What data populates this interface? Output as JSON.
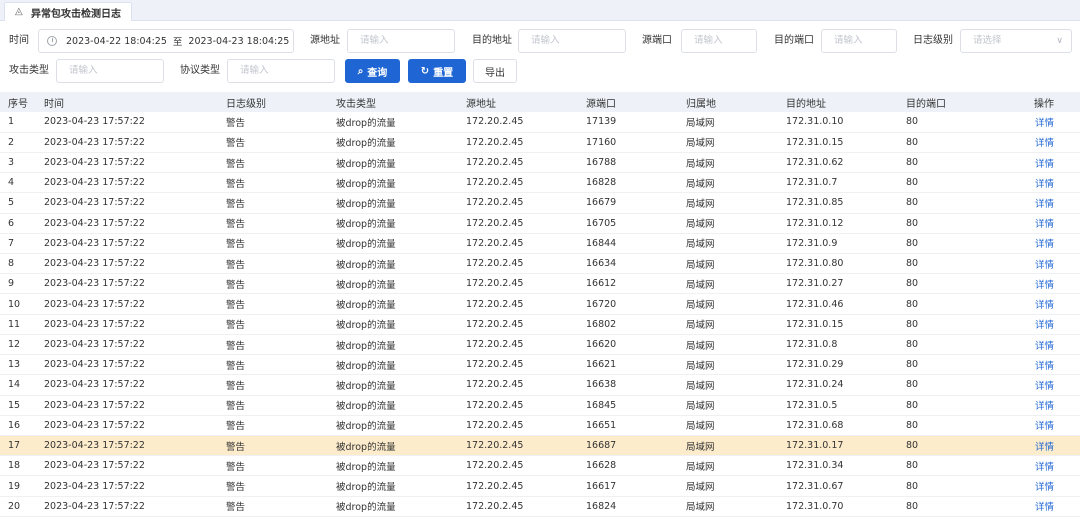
{
  "tab": {
    "title": "异常包攻击检测日志"
  },
  "filters": {
    "time_label": "时间",
    "date_start": "2023-04-22 18:04:25",
    "date_sep": "至",
    "date_end": "2023-04-23 18:04:25",
    "src_addr_label": "源地址",
    "dst_addr_label": "目的地址",
    "src_port_label": "源端口",
    "dst_port_label": "目的端口",
    "log_level_label": "日志级别",
    "attack_type_label": "攻击类型",
    "protocol_label": "协议类型",
    "input_placeholder": "请输入",
    "select_placeholder": "请选择",
    "search_btn": "查询",
    "reset_btn": "重置",
    "export_btn": "导出"
  },
  "table": {
    "headers": [
      "序号",
      "时间",
      "日志级别",
      "攻击类型",
      "源地址",
      "源端口",
      "归属地",
      "目的地址",
      "目的端口",
      "操作"
    ],
    "highlight_row": 17,
    "highlight_color": "#fdeccb",
    "accent_color": "#1f66d4",
    "rows": [
      [
        "1",
        "2023-04-23 17:57:22",
        "警告",
        "被drop的流量",
        "172.20.2.45",
        "17139",
        "局域网",
        "172.31.0.10",
        "80",
        "详情"
      ],
      [
        "2",
        "2023-04-23 17:57:22",
        "警告",
        "被drop的流量",
        "172.20.2.45",
        "17160",
        "局域网",
        "172.31.0.15",
        "80",
        "详情"
      ],
      [
        "3",
        "2023-04-23 17:57:22",
        "警告",
        "被drop的流量",
        "172.20.2.45",
        "16788",
        "局域网",
        "172.31.0.62",
        "80",
        "详情"
      ],
      [
        "4",
        "2023-04-23 17:57:22",
        "警告",
        "被drop的流量",
        "172.20.2.45",
        "16828",
        "局域网",
        "172.31.0.7",
        "80",
        "详情"
      ],
      [
        "5",
        "2023-04-23 17:57:22",
        "警告",
        "被drop的流量",
        "172.20.2.45",
        "16679",
        "局域网",
        "172.31.0.85",
        "80",
        "详情"
      ],
      [
        "6",
        "2023-04-23 17:57:22",
        "警告",
        "被drop的流量",
        "172.20.2.45",
        "16705",
        "局域网",
        "172.31.0.12",
        "80",
        "详情"
      ],
      [
        "7",
        "2023-04-23 17:57:22",
        "警告",
        "被drop的流量",
        "172.20.2.45",
        "16844",
        "局域网",
        "172.31.0.9",
        "80",
        "详情"
      ],
      [
        "8",
        "2023-04-23 17:57:22",
        "警告",
        "被drop的流量",
        "172.20.2.45",
        "16634",
        "局域网",
        "172.31.0.80",
        "80",
        "详情"
      ],
      [
        "9",
        "2023-04-23 17:57:22",
        "警告",
        "被drop的流量",
        "172.20.2.45",
        "16612",
        "局域网",
        "172.31.0.27",
        "80",
        "详情"
      ],
      [
        "10",
        "2023-04-23 17:57:22",
        "警告",
        "被drop的流量",
        "172.20.2.45",
        "16720",
        "局域网",
        "172.31.0.46",
        "80",
        "详情"
      ],
      [
        "11",
        "2023-04-23 17:57:22",
        "警告",
        "被drop的流量",
        "172.20.2.45",
        "16802",
        "局域网",
        "172.31.0.15",
        "80",
        "详情"
      ],
      [
        "12",
        "2023-04-23 17:57:22",
        "警告",
        "被drop的流量",
        "172.20.2.45",
        "16620",
        "局域网",
        "172.31.0.8",
        "80",
        "详情"
      ],
      [
        "13",
        "2023-04-23 17:57:22",
        "警告",
        "被drop的流量",
        "172.20.2.45",
        "16621",
        "局域网",
        "172.31.0.29",
        "80",
        "详情"
      ],
      [
        "14",
        "2023-04-23 17:57:22",
        "警告",
        "被drop的流量",
        "172.20.2.45",
        "16638",
        "局域网",
        "172.31.0.24",
        "80",
        "详情"
      ],
      [
        "15",
        "2023-04-23 17:57:22",
        "警告",
        "被drop的流量",
        "172.20.2.45",
        "16845",
        "局域网",
        "172.31.0.5",
        "80",
        "详情"
      ],
      [
        "16",
        "2023-04-23 17:57:22",
        "警告",
        "被drop的流量",
        "172.20.2.45",
        "16651",
        "局域网",
        "172.31.0.68",
        "80",
        "详情"
      ],
      [
        "17",
        "2023-04-23 17:57:22",
        "警告",
        "被drop的流量",
        "172.20.2.45",
        "16687",
        "局域网",
        "172.31.0.17",
        "80",
        "详情"
      ],
      [
        "18",
        "2023-04-23 17:57:22",
        "警告",
        "被drop的流量",
        "172.20.2.45",
        "16628",
        "局域网",
        "172.31.0.34",
        "80",
        "详情"
      ],
      [
        "19",
        "2023-04-23 17:57:22",
        "警告",
        "被drop的流量",
        "172.20.2.45",
        "16617",
        "局域网",
        "172.31.0.67",
        "80",
        "详情"
      ],
      [
        "20",
        "2023-04-23 17:57:22",
        "警告",
        "被drop的流量",
        "172.20.2.45",
        "16824",
        "局域网",
        "172.31.0.70",
        "80",
        "详情"
      ]
    ]
  }
}
